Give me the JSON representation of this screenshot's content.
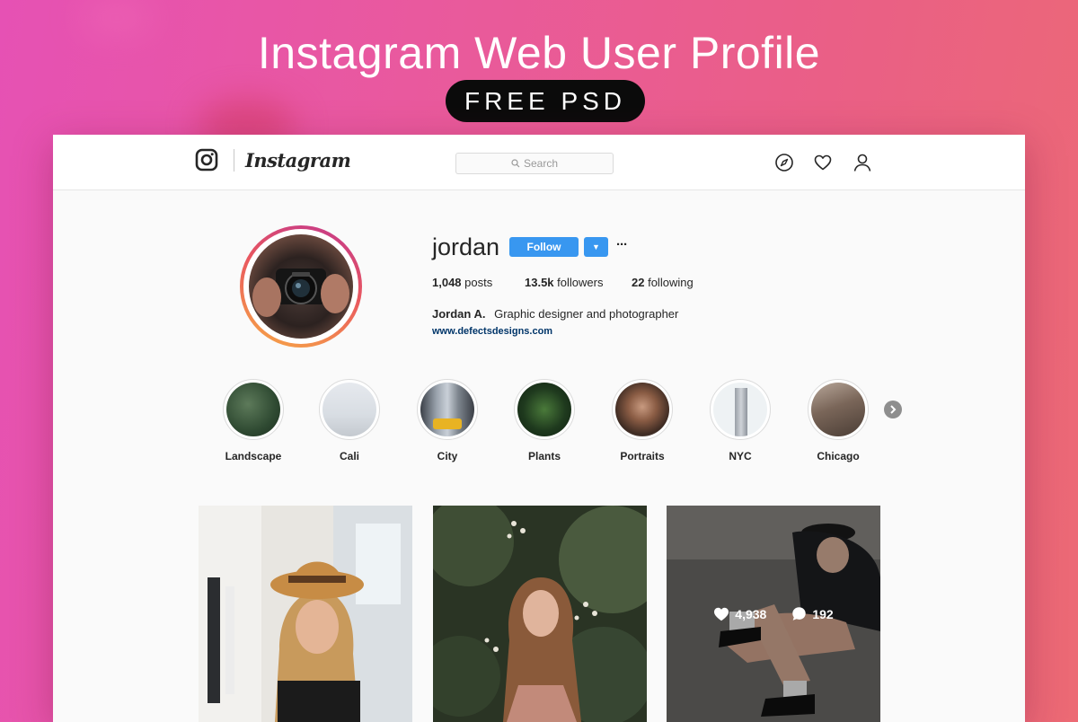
{
  "banner": {
    "title": "Instagram Web User Profile",
    "badge": "FREE PSD"
  },
  "header": {
    "wordmark": "Instagram",
    "search_placeholder": "Search",
    "icons": [
      "compass-icon",
      "heart-icon",
      "person-icon"
    ]
  },
  "profile": {
    "username": "jordan",
    "follow_label": "Follow",
    "dropdown_glyph": "▼",
    "more_glyph": "···",
    "stats": {
      "posts_count": "1,048",
      "posts_label": "posts",
      "followers_count": "13.5k",
      "followers_label": "followers",
      "following_count": "22",
      "following_label": "following"
    },
    "full_name": "Jordan A.",
    "bio": "Graphic designer and photographer",
    "website": "www.defectsdesigns.com"
  },
  "highlights": [
    {
      "label": "Landscape"
    },
    {
      "label": "Cali"
    },
    {
      "label": "City"
    },
    {
      "label": "Plants"
    },
    {
      "label": "Portraits"
    },
    {
      "label": "NYC"
    },
    {
      "label": "Chicago"
    }
  ],
  "posts": [
    {
      "likes": "",
      "comments": ""
    },
    {
      "likes": "",
      "comments": ""
    },
    {
      "likes": "4,938",
      "comments": "192"
    }
  ],
  "colors": {
    "accent": "#3897f0",
    "link": "#003569",
    "text": "#262626"
  }
}
